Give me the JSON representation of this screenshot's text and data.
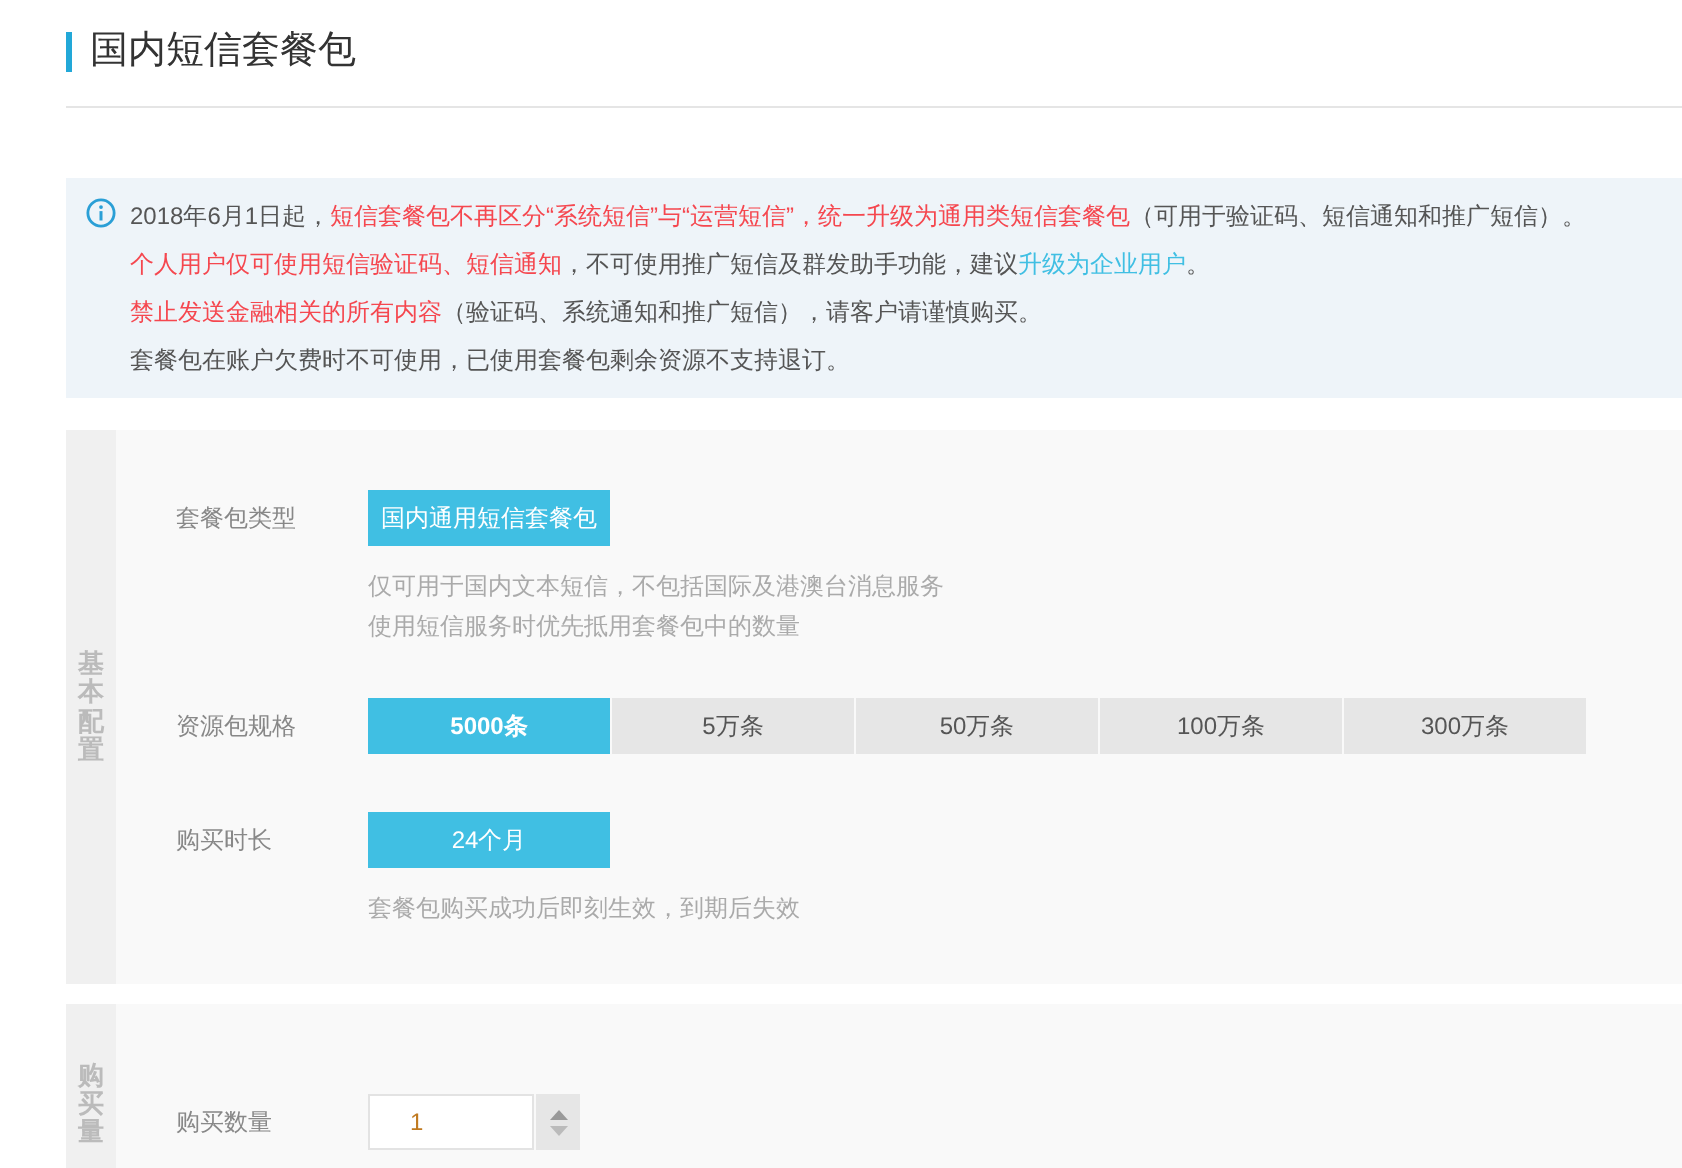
{
  "page_title": "国内短信套餐包",
  "notice": [
    {
      "segments": [
        {
          "kind": "normal",
          "text": "2018年6月1日起，"
        },
        {
          "kind": "red",
          "text": "短信套餐包不再区分“系统短信”与“运营短信”，统一升级为通用类短信套餐包"
        },
        {
          "kind": "normal",
          "text": "（可用于验证码、短信通知和推广短信）。"
        }
      ]
    },
    {
      "segments": [
        {
          "kind": "red",
          "text": "个人用户仅可使用短信验证码、短信通知"
        },
        {
          "kind": "normal",
          "text": "，不可使用推广短信及群发助手功能，建议"
        },
        {
          "kind": "link",
          "text": "升级为企业用户"
        },
        {
          "kind": "normal",
          "text": "。"
        }
      ]
    },
    {
      "segments": [
        {
          "kind": "red",
          "text": "禁止发送金融相关的所有内容"
        },
        {
          "kind": "normal",
          "text": "（验证码、系统通知和推广短信），请客户请谨慎购买。"
        }
      ]
    },
    {
      "segments": [
        {
          "kind": "normal",
          "text": "套餐包在账户欠费时不可使用，已使用套餐包剩余资源不支持退订。"
        }
      ]
    }
  ],
  "basic_config": {
    "side_label": "基本配置",
    "package_type": {
      "label": "套餐包类型",
      "options": [
        {
          "text": "国内通用短信套餐包",
          "selected": true
        }
      ],
      "notes": [
        "仅可用于国内文本短信，不包括国际及港澳台消息服务",
        "使用短信服务时优先抵用套餐包中的数量"
      ]
    },
    "spec": {
      "label": "资源包规格",
      "options": [
        {
          "text": "5000条",
          "selected": true
        },
        {
          "text": "5万条",
          "selected": false
        },
        {
          "text": "50万条",
          "selected": false
        },
        {
          "text": "100万条",
          "selected": false
        },
        {
          "text": "300万条",
          "selected": false
        }
      ]
    },
    "duration": {
      "label": "购买时长",
      "options": [
        {
          "text": "24个月",
          "selected": true
        }
      ],
      "notes": [
        "套餐包购买成功后即刻生效，到期后失效"
      ]
    }
  },
  "purchase": {
    "side_label": "购买量",
    "quantity_label": "购买数量",
    "quantity": "1"
  }
}
